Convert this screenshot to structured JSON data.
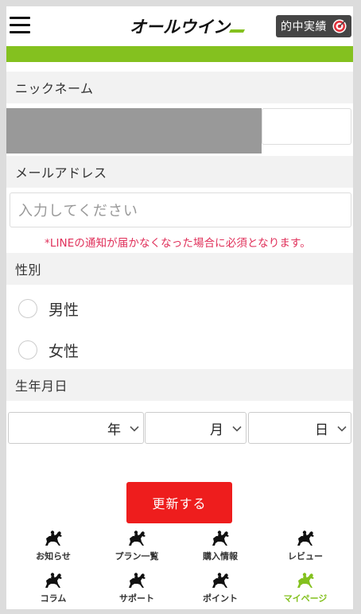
{
  "header": {
    "logo_text": "オールウイン",
    "record_button_label": "的中実績",
    "menu_icon": "hamburger-menu-icon",
    "record_icon": "target-icon"
  },
  "colors": {
    "brand_green": "#84c11f",
    "submit_red": "#ee1d1d",
    "note_pink": "#e0305a"
  },
  "form": {
    "nickname_label": "ニックネーム",
    "email_label": "メールアドレス",
    "email_placeholder": "入力してください",
    "email_note": "*LINEの通知が届かなくなった場合に必須となります。",
    "gender_label": "性別",
    "gender_options": [
      "男性",
      "女性"
    ],
    "birthdate_label": "生年月日",
    "year_suffix": "年",
    "month_suffix": "月",
    "day_suffix": "日",
    "submit_label": "更新する"
  },
  "bottom_nav": {
    "items": [
      {
        "label": "お知らせ",
        "icon": "horse-jockey-icon"
      },
      {
        "label": "プラン一覧",
        "icon": "horse-jockey-icon"
      },
      {
        "label": "購入情報",
        "icon": "horse-jockey-icon"
      },
      {
        "label": "レビュー",
        "icon": "horse-jockey-icon"
      },
      {
        "label": "コラム",
        "icon": "horse-jockey-icon"
      },
      {
        "label": "サポート",
        "icon": "horse-jockey-icon"
      },
      {
        "label": "ポイント",
        "icon": "horse-jockey-icon"
      },
      {
        "label": "マイページ",
        "icon": "horse-jockey-icon",
        "active": true
      }
    ]
  }
}
